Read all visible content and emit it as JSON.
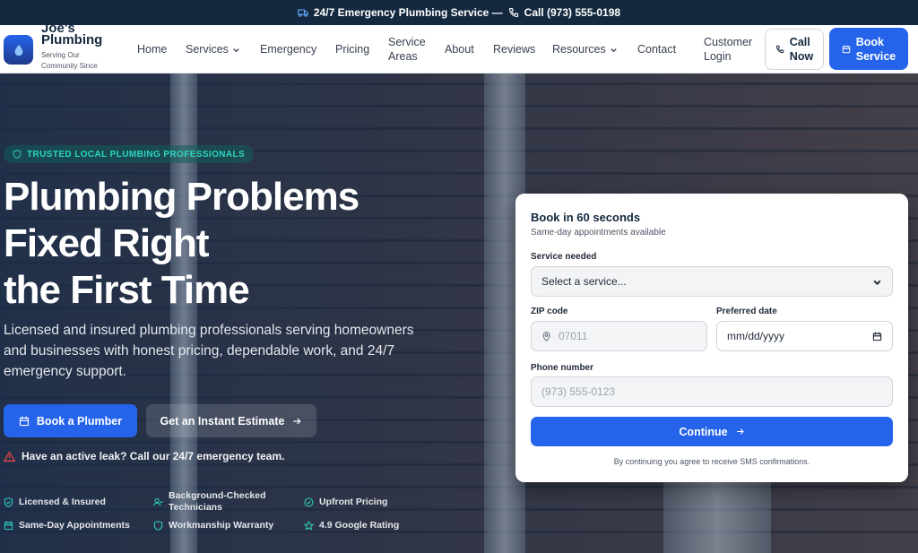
{
  "topbar": {
    "service_text": "24/7 Emergency Plumbing Service —",
    "call_text": "Call (973) 555-0198"
  },
  "brand": {
    "name_line1": "Joe's",
    "name_line2": "Plumbing",
    "tagline_line1": "Serving Our",
    "tagline_line2": "Community Since"
  },
  "nav": {
    "home": "Home",
    "services": "Services",
    "emergency": "Emergency",
    "pricing": "Pricing",
    "service_areas_1": "Service",
    "service_areas_2": "Areas",
    "about": "About",
    "reviews": "Reviews",
    "resources": "Resources",
    "contact": "Contact",
    "login_1": "Customer",
    "login_2": "Login",
    "call_1": "Call",
    "call_2": "Now",
    "book_1": "Book",
    "book_2": "Service"
  },
  "hero": {
    "badge": "TRUSTED LOCAL PLUMBING PROFESSIONALS",
    "headline_1": "Plumbing Problems",
    "headline_2": "Fixed Right",
    "headline_3": "the First Time",
    "sub": "Licensed and insured plumbing professionals serving homeowners and businesses with honest pricing, dependable work, and 24/7 emergency support.",
    "btn_book": "Book a Plumber",
    "btn_estimate": "Get an Instant Estimate",
    "alert": "Have an active leak? Call our 24/7 emergency team.",
    "features": {
      "f1": "Licensed & Insured",
      "f2_1": "Background-Checked",
      "f2_2": "Technicians",
      "f3": "Upfront Pricing",
      "f4": "Same-Day Appointments",
      "f5": "Workmanship Warranty",
      "f6": "4.9 Google Rating"
    }
  },
  "form": {
    "title": "Book in 60 seconds",
    "subtitle": "Same-day appointments available",
    "service_label": "Service needed",
    "service_value": "Select a service...",
    "zip_label": "ZIP code",
    "zip_placeholder": "07011",
    "date_label": "Preferred date",
    "date_value": "mm/dd/yyyy",
    "phone_label": "Phone number",
    "phone_placeholder": "(973) 555-0123",
    "continue": "Continue",
    "note": "By continuing you agree to receive SMS confirmations."
  },
  "colors": {
    "primary": "#2563eb",
    "navy": "#14283f",
    "teal": "#2dd4bf",
    "alert_red": "#ef4444"
  }
}
